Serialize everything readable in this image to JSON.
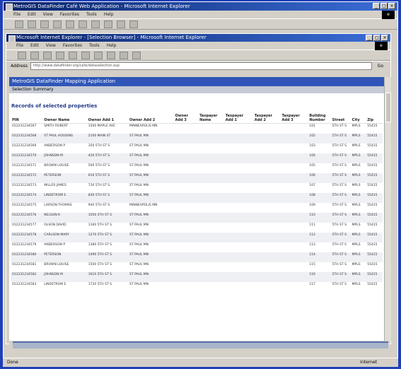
{
  "outer_window": {
    "title": "MetroGIS DataFinder Café Web Application - Microsoft Internet Explorer",
    "menu": [
      "File",
      "Edit",
      "View",
      "Favorites",
      "Tools",
      "Help"
    ],
    "toolbar_icons": [
      "back-icon",
      "forward-icon",
      "stop-icon",
      "refresh-icon",
      "home-icon",
      "search-icon",
      "favorites-icon",
      "history-icon",
      "mail-icon",
      "print-icon"
    ]
  },
  "inner_window": {
    "title": "Microsoft Internet Explorer - [Selection Browser] - Microsoft Internet Explorer",
    "menu": [
      "File",
      "Edit",
      "View",
      "Favorites",
      "Tools",
      "Help"
    ],
    "address_label": "Address",
    "address_value": "http://www.datafinder.org/cafe/dataselection.asp",
    "go_label": "Go"
  },
  "app": {
    "banner": "MetroGIS DataFinder Mapping Application",
    "section": "Selection Summary",
    "records_title": "Records of selected properties"
  },
  "table": {
    "headers": [
      "PIN",
      "Owner Name",
      "Owner Add 1",
      "Owner Add 2",
      "Owner Add 3",
      "Taxpayer Name",
      "Taxpayer Add 1",
      "Taxpayer Add 2",
      "Taxpayer Add 3",
      "Building Number",
      "Street",
      "City",
      "Zip"
    ],
    "rows": [
      [
        "012231234567",
        "SMITH ROBERT",
        "1500 MAPLE AVE",
        "MINNEAPOLIS MN",
        "",
        "",
        "",
        "",
        "",
        "101",
        "5TH ST S",
        "MPLS",
        "55415"
      ],
      [
        "012231234568",
        "ST PAUL HOUSING",
        "2100 MAIN ST",
        "ST PAUL MN",
        "",
        "",
        "",
        "",
        "",
        "102",
        "5TH ST S",
        "MPLS",
        "55415"
      ],
      [
        "012231234569",
        "ANDERSON P",
        "350 5TH ST S",
        "ST PAUL MN",
        "",
        "",
        "",
        "",
        "",
        "103",
        "5TH ST S",
        "MPLS",
        "55415"
      ],
      [
        "012231234570",
        "JOHNSON M",
        "420 5TH ST S",
        "ST PAUL MN",
        "",
        "",
        "",
        "",
        "",
        "104",
        "5TH ST S",
        "MPLS",
        "55415"
      ],
      [
        "012231234571",
        "BROWN LOUISE",
        "500 5TH ST S",
        "ST PAUL MN",
        "",
        "",
        "",
        "",
        "",
        "105",
        "5TH ST S",
        "MPLS",
        "55415"
      ],
      [
        "012231234572",
        "PETERSON",
        "610 5TH ST S",
        "ST PAUL MN",
        "",
        "",
        "",
        "",
        "",
        "106",
        "5TH ST S",
        "MPLS",
        "55415"
      ],
      [
        "012231234573",
        "MILLER JAMES",
        "720 5TH ST S",
        "ST PAUL MN",
        "",
        "",
        "",
        "",
        "",
        "107",
        "5TH ST S",
        "MPLS",
        "55415"
      ],
      [
        "012231234574",
        "LINDSTROM E",
        "830 5TH ST S",
        "ST PAUL MN",
        "",
        "",
        "",
        "",
        "",
        "108",
        "5TH ST S",
        "MPLS",
        "55415"
      ],
      [
        "012231234575",
        "LARSON THOMAS",
        "940 5TH ST S",
        "MINNEAPOLIS MN",
        "",
        "",
        "",
        "",
        "",
        "109",
        "5TH ST S",
        "MPLS",
        "55415"
      ],
      [
        "012231234576",
        "NELSON K",
        "1050 5TH ST S",
        "ST PAUL MN",
        "",
        "",
        "",
        "",
        "",
        "110",
        "5TH ST S",
        "MPLS",
        "55415"
      ],
      [
        "012231234577",
        "OLSON DAVID",
        "1160 5TH ST S",
        "ST PAUL MN",
        "",
        "",
        "",
        "",
        "",
        "111",
        "5TH ST S",
        "MPLS",
        "55415"
      ],
      [
        "012231234578",
        "CARLSON MARY",
        "1270 5TH ST S",
        "ST PAUL MN",
        "",
        "",
        "",
        "",
        "",
        "112",
        "5TH ST S",
        "MPLS",
        "55415"
      ],
      [
        "012231234579",
        "ANDERSON P",
        "1380 5TH ST S",
        "ST PAUL MN",
        "",
        "",
        "",
        "",
        "",
        "113",
        "5TH ST S",
        "MPLS",
        "55415"
      ],
      [
        "012231234580",
        "PETERSON",
        "1490 5TH ST S",
        "ST PAUL MN",
        "",
        "",
        "",
        "",
        "",
        "114",
        "5TH ST S",
        "MPLS",
        "55415"
      ],
      [
        "012231234581",
        "BROWN LOUISE",
        "1500 5TH ST S",
        "ST PAUL MN",
        "",
        "",
        "",
        "",
        "",
        "115",
        "5TH ST S",
        "MPLS",
        "55415"
      ],
      [
        "012231234582",
        "JOHNSON M",
        "1610 5TH ST S",
        "ST PAUL MN",
        "",
        "",
        "",
        "",
        "",
        "116",
        "5TH ST S",
        "MPLS",
        "55415"
      ],
      [
        "012231234583",
        "LINDSTROM E",
        "1720 5TH ST S",
        "ST PAUL MN",
        "",
        "",
        "",
        "",
        "",
        "117",
        "5TH ST S",
        "MPLS",
        "55415"
      ]
    ]
  },
  "inner_status": {
    "left": "Done",
    "right": "Internet"
  },
  "outer_status": {
    "left": "Done",
    "right": "Internet"
  }
}
